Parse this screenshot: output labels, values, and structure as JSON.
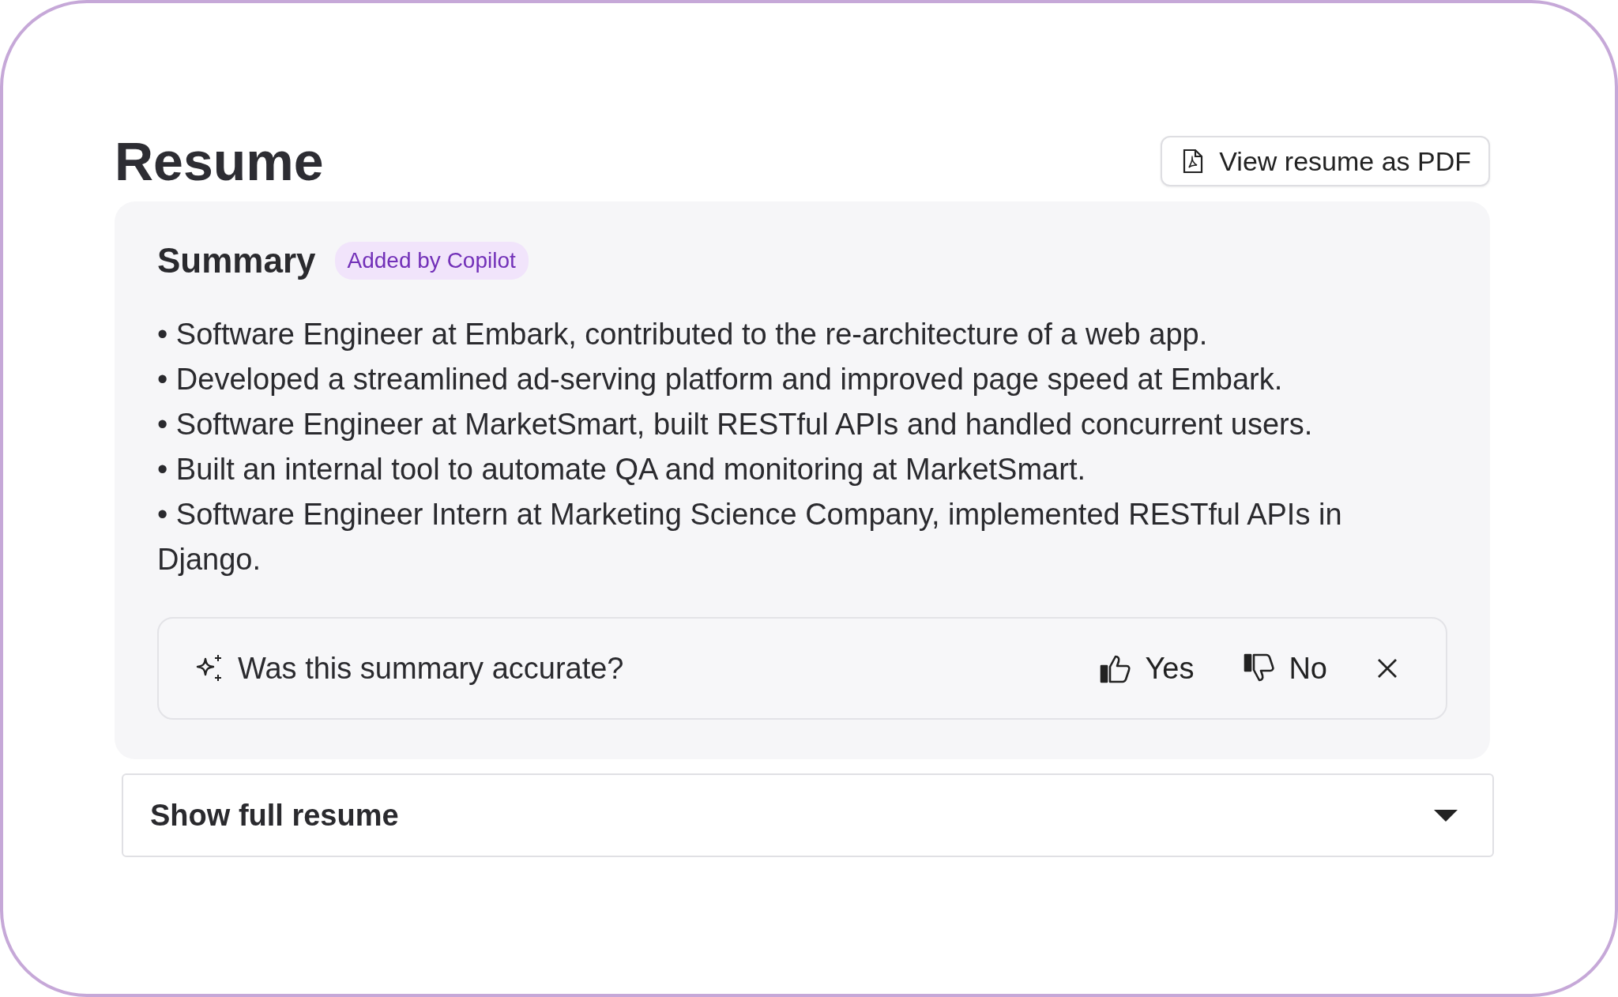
{
  "title": "Resume",
  "pdf_button": {
    "label": "View resume as PDF"
  },
  "summary": {
    "heading": "Summary",
    "badge": "Added by Copilot",
    "bullets": [
      "• Software Engineer at Embark, contributed to the re-architecture of a web app.",
      "• Developed a streamlined ad-serving platform and improved page speed at Embark.",
      "• Software Engineer at MarketSmart, built RESTful APIs and handled concurrent users.",
      "• Built an internal tool to automate QA and monitoring at MarketSmart.",
      "• Software Engineer Intern at Marketing Science Company, implemented RESTful APIs in Django."
    ]
  },
  "feedback": {
    "question": "Was this summary accurate?",
    "yes": "Yes",
    "no": "No"
  },
  "expander": {
    "label": "Show full resume",
    "expanded": false
  }
}
